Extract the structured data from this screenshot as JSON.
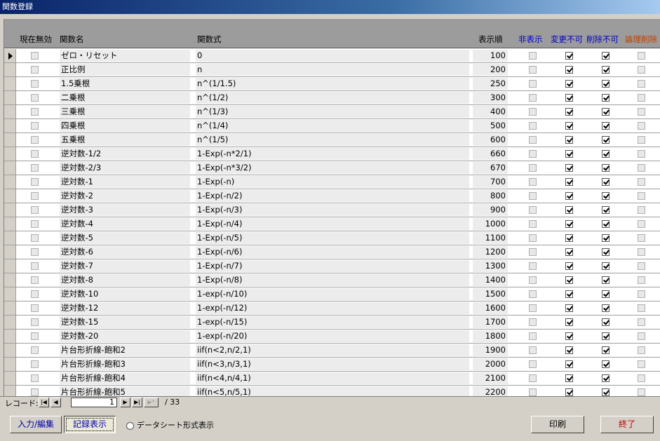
{
  "window": {
    "title": "関数登録"
  },
  "columns": {
    "invalid": "現在無効",
    "name": "関数名",
    "expr": "関数式",
    "order": "表示順",
    "hidden": "非表示",
    "no_change": "変更不可",
    "no_delete": "削除不可",
    "logical_delete": "論理削除"
  },
  "header_colors": {
    "blue": "#0000cc",
    "red": "#c04000"
  },
  "rows": [
    {
      "name": "ゼロ・リセット",
      "expr": "0",
      "order": "100",
      "hidden": false,
      "no_change": true,
      "no_delete": true,
      "logical_delete": false
    },
    {
      "name": "正比例",
      "expr": "n",
      "order": "200",
      "hidden": false,
      "no_change": true,
      "no_delete": true,
      "logical_delete": false
    },
    {
      "name": "1.5乗根",
      "expr": "n^(1/1.5)",
      "order": "250",
      "hidden": false,
      "no_change": true,
      "no_delete": true,
      "logical_delete": false
    },
    {
      "name": "二乗根",
      "expr": "n^(1/2)",
      "order": "300",
      "hidden": false,
      "no_change": true,
      "no_delete": true,
      "logical_delete": false
    },
    {
      "name": "三乗根",
      "expr": "n^(1/3)",
      "order": "400",
      "hidden": false,
      "no_change": true,
      "no_delete": true,
      "logical_delete": false
    },
    {
      "name": "四乗根",
      "expr": "n^(1/4)",
      "order": "500",
      "hidden": false,
      "no_change": true,
      "no_delete": true,
      "logical_delete": false
    },
    {
      "name": "五乗根",
      "expr": "n^(1/5)",
      "order": "600",
      "hidden": false,
      "no_change": true,
      "no_delete": true,
      "logical_delete": false
    },
    {
      "name": "逆対数-1/2",
      "expr": "1-Exp(-n*2/1)",
      "order": "660",
      "hidden": false,
      "no_change": true,
      "no_delete": true,
      "logical_delete": false
    },
    {
      "name": "逆対数-2/3",
      "expr": "1-Exp(-n*3/2)",
      "order": "670",
      "hidden": false,
      "no_change": true,
      "no_delete": true,
      "logical_delete": false
    },
    {
      "name": "逆対数-1",
      "expr": "1-Exp(-n)",
      "order": "700",
      "hidden": false,
      "no_change": true,
      "no_delete": true,
      "logical_delete": false
    },
    {
      "name": "逆対数-2",
      "expr": "1-Exp(-n/2)",
      "order": "800",
      "hidden": false,
      "no_change": true,
      "no_delete": true,
      "logical_delete": false
    },
    {
      "name": "逆対数-3",
      "expr": "1-Exp(-n/3)",
      "order": "900",
      "hidden": false,
      "no_change": true,
      "no_delete": true,
      "logical_delete": false
    },
    {
      "name": "逆対数-4",
      "expr": "1-Exp(-n/4)",
      "order": "1000",
      "hidden": false,
      "no_change": true,
      "no_delete": true,
      "logical_delete": false
    },
    {
      "name": "逆対数-5",
      "expr": "1-Exp(-n/5)",
      "order": "1100",
      "hidden": false,
      "no_change": true,
      "no_delete": true,
      "logical_delete": false
    },
    {
      "name": "逆対数-6",
      "expr": "1-Exp(-n/6)",
      "order": "1200",
      "hidden": false,
      "no_change": true,
      "no_delete": true,
      "logical_delete": false
    },
    {
      "name": "逆対数-7",
      "expr": "1-Exp(-n/7)",
      "order": "1300",
      "hidden": false,
      "no_change": true,
      "no_delete": true,
      "logical_delete": false
    },
    {
      "name": "逆対数-8",
      "expr": "1-Exp(-n/8)",
      "order": "1400",
      "hidden": false,
      "no_change": true,
      "no_delete": true,
      "logical_delete": false
    },
    {
      "name": "逆対数-10",
      "expr": "1-exp(-n/10)",
      "order": "1500",
      "hidden": false,
      "no_change": true,
      "no_delete": true,
      "logical_delete": false
    },
    {
      "name": "逆対数-12",
      "expr": "1-exp(-n/12)",
      "order": "1600",
      "hidden": false,
      "no_change": true,
      "no_delete": true,
      "logical_delete": false
    },
    {
      "name": "逆対数-15",
      "expr": "1-exp(-n/15)",
      "order": "1700",
      "hidden": false,
      "no_change": true,
      "no_delete": true,
      "logical_delete": false
    },
    {
      "name": "逆対数-20",
      "expr": "1-exp(-n/20)",
      "order": "1800",
      "hidden": false,
      "no_change": true,
      "no_delete": true,
      "logical_delete": false
    },
    {
      "name": "片台形折線-飽和2",
      "expr": "iif(n<2,n/2,1)",
      "order": "1900",
      "hidden": false,
      "no_change": true,
      "no_delete": true,
      "logical_delete": false
    },
    {
      "name": "片台形折線-飽和3",
      "expr": "iif(n<3,n/3,1)",
      "order": "2000",
      "hidden": false,
      "no_change": true,
      "no_delete": true,
      "logical_delete": false
    },
    {
      "name": "片台形折線-飽和4",
      "expr": "iif(n<4,n/4,1)",
      "order": "2100",
      "hidden": false,
      "no_change": true,
      "no_delete": true,
      "logical_delete": false
    },
    {
      "name": "片台形折線-飽和5",
      "expr": "iif(n<5,n/5,1)",
      "order": "2200",
      "hidden": false,
      "no_change": true,
      "no_delete": true,
      "logical_delete": false
    }
  ],
  "navigation": {
    "label": "レコード:",
    "current": "1",
    "total": "/ 33"
  },
  "footer": {
    "input_edit": "入力/編集",
    "record_view": "記録表示",
    "datasheet_view": "データシート形式表示",
    "print": "印刷",
    "exit": "終了"
  }
}
